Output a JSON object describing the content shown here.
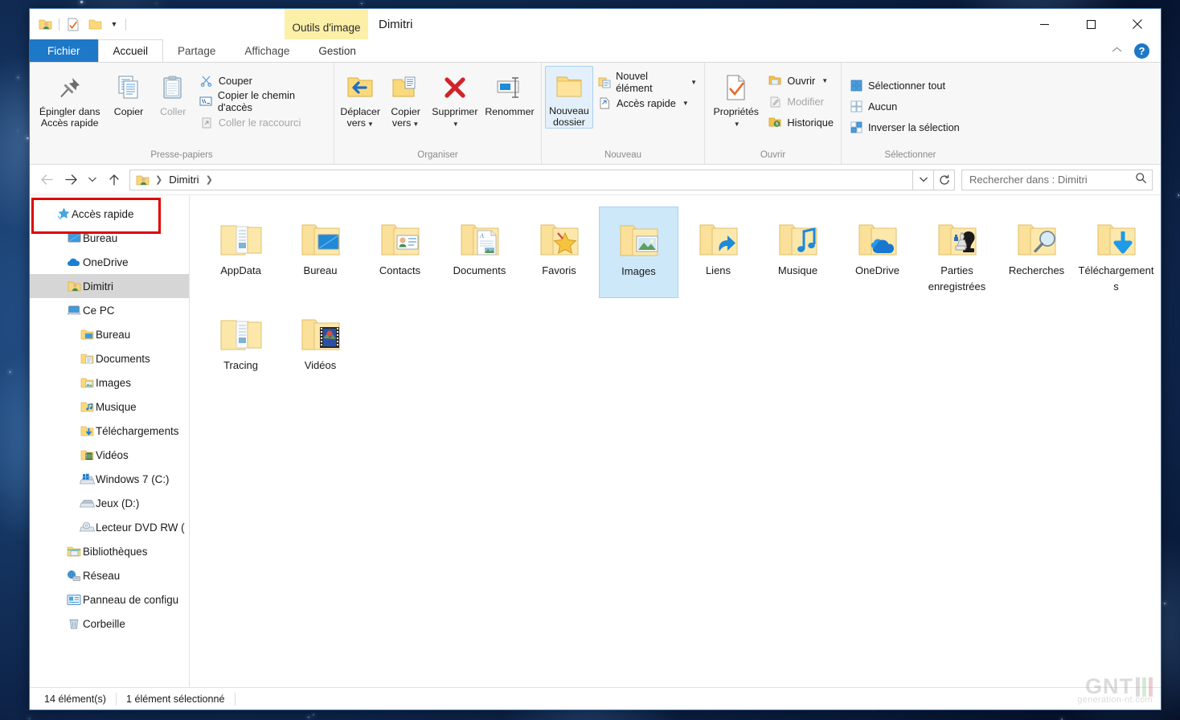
{
  "window": {
    "title": "Dimitri",
    "contextual_tab_group": "Outils d'image",
    "controls": {
      "minimize": "minimize-icon",
      "maximize": "maximize-icon",
      "close": "close-icon"
    }
  },
  "quick_access_toolbar": {
    "items": [
      {
        "name": "user-folder-icon",
        "label": "Dimitri"
      },
      {
        "name": "properties-icon",
        "label": "Propriétés"
      },
      {
        "name": "new-folder-icon",
        "label": "Nouveau dossier"
      },
      {
        "name": "customize-caret-icon",
        "label": "Personnaliser"
      }
    ]
  },
  "tabs": [
    {
      "id": "fichier",
      "label": "Fichier",
      "state": "file"
    },
    {
      "id": "accueil",
      "label": "Accueil",
      "state": "active"
    },
    {
      "id": "partage",
      "label": "Partage",
      "state": "normal"
    },
    {
      "id": "affichage",
      "label": "Affichage",
      "state": "normal"
    },
    {
      "id": "gestion",
      "label": "Gestion",
      "state": "contextual"
    }
  ],
  "tabstrip_right": {
    "collapse": "chevron-up-icon",
    "help": "?"
  },
  "ribbon": {
    "groups": [
      {
        "id": "presse-papiers",
        "label": "Presse-papiers",
        "big_buttons": [
          {
            "id": "epingler",
            "label": "Épingler dans\nAccès rapide",
            "line1": "Épingler dans",
            "line2": "Accès rapide",
            "icon": "pin-icon",
            "disabled": false
          },
          {
            "id": "copier",
            "label": "Copier",
            "icon": "copy-icon",
            "disabled": false
          },
          {
            "id": "coller",
            "label": "Coller",
            "icon": "paste-icon",
            "disabled": true
          }
        ],
        "small_buttons": [
          {
            "id": "couper",
            "label": "Couper",
            "icon": "scissors-icon",
            "disabled": false
          },
          {
            "id": "copier-chemin",
            "label": "Copier le chemin d'accès",
            "icon": "copy-path-icon",
            "disabled": false
          },
          {
            "id": "coller-raccourci",
            "label": "Coller le raccourci",
            "icon": "paste-shortcut-icon",
            "disabled": true
          }
        ]
      },
      {
        "id": "organiser",
        "label": "Organiser",
        "big_buttons": [
          {
            "id": "deplacer-vers",
            "line1": "Déplacer",
            "line2": "vers",
            "label": "Déplacer vers",
            "icon": "move-to-icon",
            "has_caret": true
          },
          {
            "id": "copier-vers",
            "line1": "Copier",
            "line2": "vers",
            "label": "Copier vers",
            "icon": "copy-to-icon",
            "has_caret": true
          },
          {
            "id": "supprimer",
            "label": "Supprimer",
            "icon": "delete-x-icon",
            "has_caret": true
          },
          {
            "id": "renommer",
            "label": "Renommer",
            "icon": "rename-icon",
            "has_caret": false
          }
        ]
      },
      {
        "id": "nouveau",
        "label": "Nouveau",
        "big_buttons": [
          {
            "id": "nouveau-dossier",
            "line1": "Nouveau",
            "line2": "dossier",
            "label": "Nouveau dossier",
            "icon": "new-folder-icon",
            "selected": true
          }
        ],
        "small_buttons": [
          {
            "id": "nouvel-element",
            "label": "Nouvel élément",
            "icon": "new-item-icon",
            "has_caret": true
          },
          {
            "id": "acces-rapide",
            "label": "Accès rapide",
            "icon": "easy-access-icon",
            "has_caret": true
          }
        ]
      },
      {
        "id": "ouvrir",
        "label": "Ouvrir",
        "big_buttons": [
          {
            "id": "proprietes",
            "label": "Propriétés",
            "icon": "properties-check-icon",
            "has_caret": true
          }
        ],
        "small_buttons": [
          {
            "id": "ouvrir",
            "label": "Ouvrir",
            "icon": "open-folder-icon",
            "has_caret": true,
            "disabled": false
          },
          {
            "id": "modifier",
            "label": "Modifier",
            "icon": "edit-icon",
            "disabled": true
          },
          {
            "id": "historique",
            "label": "Historique",
            "icon": "history-icon",
            "disabled": false
          }
        ]
      },
      {
        "id": "selectionner",
        "label": "Sélectionner",
        "small_buttons": [
          {
            "id": "selectionner-tout",
            "label": "Sélectionner tout",
            "icon": "select-all-icon"
          },
          {
            "id": "aucun",
            "label": "Aucun",
            "icon": "select-none-icon"
          },
          {
            "id": "inverser-selection",
            "label": "Inverser la sélection",
            "icon": "invert-selection-icon"
          }
        ]
      }
    ]
  },
  "address_bar": {
    "back": "back-arrow-icon",
    "forward": "forward-arrow-icon",
    "recent": "chevron-down-icon",
    "up": "up-arrow-icon",
    "breadcrumbs": [
      {
        "label": "",
        "icon": "user-folder-icon"
      },
      {
        "label": "Dimitri",
        "icon": null
      }
    ],
    "dropdown": "chevron-down-icon",
    "refresh": "refresh-icon",
    "search_placeholder": "Rechercher dans : Dimitri",
    "search_value": "",
    "search_icon": "search-icon"
  },
  "sidebar": {
    "items": [
      {
        "id": "acces-rapide",
        "label": "Accès rapide",
        "icon": "star-pin-icon",
        "level": 0,
        "selected": false,
        "highlighted": true
      },
      {
        "id": "bureau-qa",
        "label": "Bureau",
        "icon": "desktop-icon",
        "level": 1,
        "selected": false
      },
      {
        "id": "onedrive",
        "label": "OneDrive",
        "icon": "cloud-icon",
        "level": 1,
        "selected": false
      },
      {
        "id": "dimitri",
        "label": "Dimitri",
        "icon": "user-folder-icon",
        "level": 1,
        "selected": true
      },
      {
        "id": "ce-pc",
        "label": "Ce PC",
        "icon": "computer-icon",
        "level": 1,
        "selected": false
      },
      {
        "id": "bureau",
        "label": "Bureau",
        "icon": "folder-desktop-icon",
        "level": 2,
        "selected": false
      },
      {
        "id": "documents",
        "label": "Documents",
        "icon": "folder-documents-icon",
        "level": 2,
        "selected": false
      },
      {
        "id": "images",
        "label": "Images",
        "icon": "folder-pictures-icon",
        "level": 2,
        "selected": false
      },
      {
        "id": "musique",
        "label": "Musique",
        "icon": "folder-music-icon",
        "level": 2,
        "selected": false
      },
      {
        "id": "telechargements",
        "label": "Téléchargements",
        "icon": "folder-downloads-icon",
        "level": 2,
        "selected": false
      },
      {
        "id": "videos",
        "label": "Vidéos",
        "icon": "folder-videos-icon",
        "level": 2,
        "selected": false
      },
      {
        "id": "windows7-c",
        "label": "Windows 7 (C:)",
        "icon": "system-drive-icon",
        "level": 2,
        "selected": false
      },
      {
        "id": "jeux-d",
        "label": "Jeux (D:)",
        "icon": "drive-icon",
        "level": 2,
        "selected": false
      },
      {
        "id": "lecteur-dvd",
        "label": "Lecteur DVD RW (",
        "icon": "dvd-drive-icon",
        "level": 2,
        "selected": false
      },
      {
        "id": "bibliotheques",
        "label": "Bibliothèques",
        "icon": "libraries-icon",
        "level": 1,
        "selected": false
      },
      {
        "id": "reseau",
        "label": "Réseau",
        "icon": "network-icon",
        "level": 1,
        "selected": false
      },
      {
        "id": "panneau-config",
        "label": "Panneau de configu",
        "icon": "control-panel-icon",
        "level": 1,
        "selected": false
      },
      {
        "id": "corbeille",
        "label": "Corbeille",
        "icon": "recycle-bin-icon",
        "level": 1,
        "selected": false
      }
    ]
  },
  "content": {
    "items": [
      {
        "id": "appdata",
        "label": "AppData",
        "icon": "folder-files-icon",
        "selected": false
      },
      {
        "id": "bureau",
        "label": "Bureau",
        "icon": "folder-desktop-icon",
        "selected": false
      },
      {
        "id": "contacts",
        "label": "Contacts",
        "icon": "folder-contacts-icon",
        "selected": false
      },
      {
        "id": "documents",
        "label": "Documents",
        "icon": "folder-documents-icon",
        "selected": false
      },
      {
        "id": "favoris",
        "label": "Favoris",
        "icon": "folder-favorites-icon",
        "selected": false
      },
      {
        "id": "images",
        "label": "Images",
        "icon": "folder-pictures-icon",
        "selected": true
      },
      {
        "id": "liens",
        "label": "Liens",
        "icon": "folder-links-icon",
        "selected": false
      },
      {
        "id": "musique",
        "label": "Musique",
        "icon": "folder-music-icon",
        "selected": false
      },
      {
        "id": "onedrive",
        "label": "OneDrive",
        "icon": "folder-onedrive-icon",
        "selected": false
      },
      {
        "id": "parties-enregistrees",
        "label": "Parties enregistrées",
        "icon": "folder-saved-games-icon",
        "selected": false
      },
      {
        "id": "recherches",
        "label": "Recherches",
        "icon": "folder-searches-icon",
        "selected": false
      },
      {
        "id": "telechargements",
        "label": "Téléchargements",
        "icon": "folder-downloads-icon",
        "selected": false
      },
      {
        "id": "tracing",
        "label": "Tracing",
        "icon": "folder-files-icon",
        "selected": false
      },
      {
        "id": "videos",
        "label": "Vidéos",
        "icon": "folder-videos-icon",
        "selected": false
      }
    ]
  },
  "status_bar": {
    "item_count": "14 élément(s)",
    "selection": "1 élément sélectionné"
  },
  "watermark": {
    "brand": "GNT",
    "subtitle": "generation-nt.com"
  },
  "colors": {
    "accent": "#1e78c8",
    "contextual_tab": "#fcf0a8",
    "selection": "#cde8f9",
    "highlight_box": "#e00000",
    "folder": "#fbd97a"
  }
}
